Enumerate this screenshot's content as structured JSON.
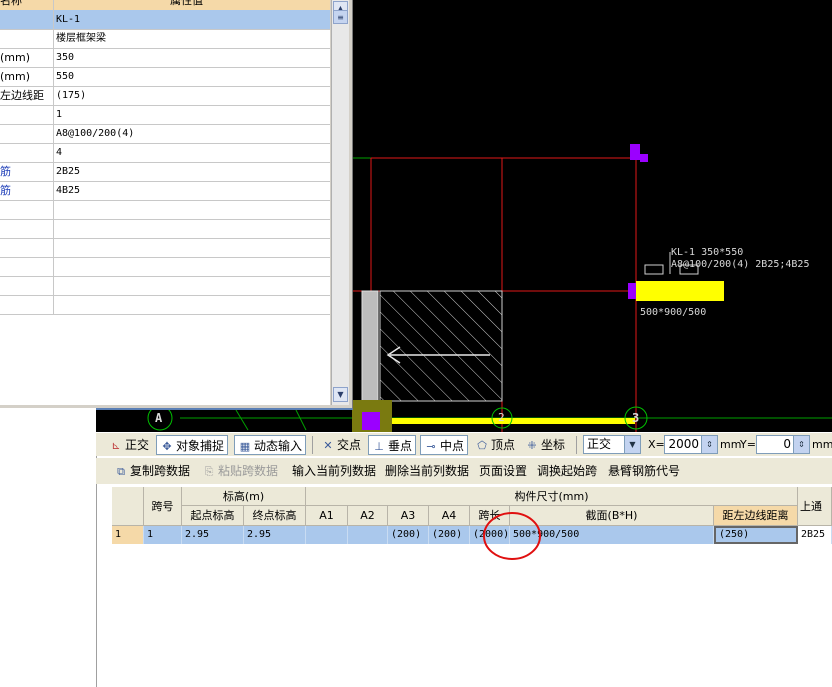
{
  "property_panel": {
    "header": {
      "name": "名称",
      "value": "属性值"
    },
    "rows": [
      {
        "name": "",
        "value": "KL-1",
        "blue": false
      },
      {
        "name": "",
        "value": "楼层框架梁",
        "blue": false
      },
      {
        "name": "(mm)",
        "value": "350",
        "blue": false
      },
      {
        "name": "(mm)",
        "value": "550",
        "blue": false
      },
      {
        "name": "左边线距",
        "value": "(175)",
        "blue": false
      },
      {
        "name": "",
        "value": "1",
        "blue": false
      },
      {
        "name": "",
        "value": "A8@100/200(4)",
        "blue": false
      },
      {
        "name": "",
        "value": "4",
        "blue": false
      },
      {
        "name": "筋",
        "value": "2B25",
        "blue": true
      },
      {
        "name": "筋",
        "value": "4B25",
        "blue": true
      },
      {
        "name": "",
        "value": "",
        "blue": false
      },
      {
        "name": "",
        "value": "",
        "blue": false
      },
      {
        "name": "",
        "value": "",
        "blue": false
      },
      {
        "name": "",
        "value": "",
        "blue": false
      },
      {
        "name": "",
        "value": "",
        "blue": false
      },
      {
        "name": "",
        "value": "",
        "blue": false
      }
    ]
  },
  "cad": {
    "beam_label_line1": "KL-1 350*550",
    "beam_label_line2": "A8@100/200(4) 2B25;4B25",
    "section_label": "500*900/500",
    "axis_labels": [
      "A",
      "2",
      "3"
    ],
    "colors": {
      "beam": "#ffff00",
      "grid_line": "#e01818",
      "marker": "#9b00ff",
      "axis_circle": "#00c000"
    }
  },
  "toolbar": {
    "ortho": "正交",
    "snap": "对象捕捉",
    "dynamic_input": "动态输入",
    "intersection": "交点",
    "perpendicular": "垂点",
    "midpoint": "中点",
    "vertex": "顶点",
    "coordinate": "坐标",
    "mode_select": "正交",
    "x_label": "X=",
    "x_value": "2000",
    "unit1": "mm",
    "y_label": "Y=",
    "y_value": "0",
    "unit2": "mm"
  },
  "actions": {
    "copy_span": "复制跨数据",
    "paste_span": "粘贴跨数据",
    "input_column": "输入当前列数据",
    "delete_column": "删除当前列数据",
    "page_setup": "页面设置",
    "adjust_start": "调换起始跨",
    "cantilever_code": "悬臂钢筋代号"
  },
  "table": {
    "headers": {
      "span_no": "跨号",
      "elevation": "标高(m)",
      "start_elev": "起点标高",
      "end_elev": "终点标高",
      "dimensions": "构件尺寸(mm)",
      "a1": "A1",
      "a2": "A2",
      "a3": "A3",
      "a4": "A4",
      "span_len": "跨长",
      "section": "截面(B*H)",
      "left_dist": "距左边线距离",
      "top_through": "上通"
    },
    "rows": [
      {
        "row_no": "1",
        "span": "1",
        "start_elev": "2.95",
        "end_elev": "2.95",
        "a1": "",
        "a2": "",
        "a3": "(200)",
        "a4": "(200)",
        "span_len": "(2000)",
        "section": "500*900/500",
        "left_dist": "(250)",
        "top_through": "2B25"
      }
    ]
  }
}
